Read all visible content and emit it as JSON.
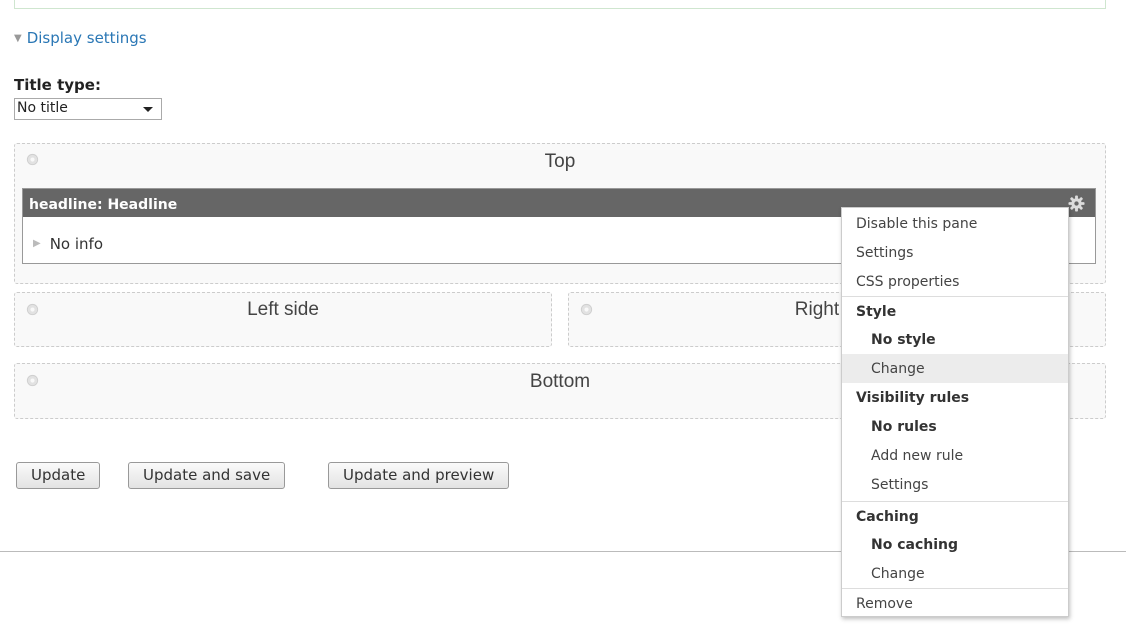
{
  "display_settings": {
    "legend": "Display settings"
  },
  "title_type": {
    "label": "Title type:",
    "selected": "No title"
  },
  "regions": {
    "top": "Top",
    "left": "Left side",
    "right": "Right side",
    "bottom": "Bottom"
  },
  "pane": {
    "title": "headline: Headline",
    "info": "No info"
  },
  "buttons": {
    "update": "Update",
    "update_save": "Update and save",
    "update_preview": "Update and preview"
  },
  "menu": {
    "disable": "Disable this pane",
    "settings": "Settings",
    "css": "CSS properties",
    "style_heading": "Style",
    "style_value": "No style",
    "style_change": "Change",
    "visibility_heading": "Visibility rules",
    "visibility_value": "No rules",
    "add_rule": "Add new rule",
    "visibility_settings": "Settings",
    "caching_heading": "Caching",
    "caching_value": "No caching",
    "caching_change": "Change",
    "remove": "Remove"
  },
  "icons": {
    "gear": "gear-icon",
    "triangle": "triangle-icon"
  },
  "colors": {
    "link": "#2a77b5",
    "pane_header": "#666666",
    "menu_highlight": "#ececec"
  }
}
